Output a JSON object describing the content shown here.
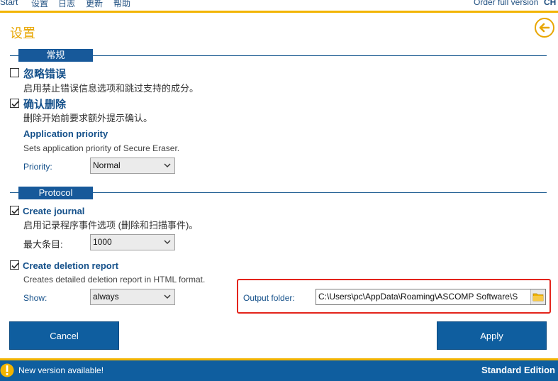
{
  "menu": {
    "items": [
      "Start",
      "设置",
      "日志",
      "更新",
      "帮助"
    ],
    "order_label": "Order full version",
    "lang_label": "CH"
  },
  "page": {
    "title": "设置"
  },
  "sections": {
    "general": "常规",
    "protocol": "Protocol"
  },
  "options": {
    "ignore_errors": {
      "title": "忽略错误",
      "desc": "启用禁止错误信息选项和跳过支持的成分。",
      "checked": false
    },
    "confirm_delete": {
      "title": "确认删除",
      "desc": "删除开始前要求额外提示确认。",
      "checked": true
    },
    "app_priority": {
      "title": "Application priority",
      "desc": "Sets application priority of Secure Eraser.",
      "label": "Priority:",
      "value": "Normal"
    },
    "create_journal": {
      "title": "Create journal",
      "desc": "启用记录程序事件选项 (删除和扫描事件)。",
      "label": "最大条目:",
      "value": "1000",
      "checked": true
    },
    "deletion_report": {
      "title": "Create deletion report",
      "desc": "Creates detailed deletion report in HTML format.",
      "label": "Show:",
      "value": "always",
      "checked": true
    },
    "output_folder": {
      "label": "Output folder:",
      "value": "C:\\Users\\pc\\AppData\\Roaming\\ASCOMP Software\\S"
    }
  },
  "buttons": {
    "cancel": "Cancel",
    "apply": "Apply"
  },
  "status": {
    "message": "New version available!",
    "edition": "Standard Edition"
  },
  "icons": {
    "back": "back-arrow-icon",
    "folder": "folder-icon",
    "warning": "warning-icon",
    "chevron": "chevron-down-icon",
    "check": "check-icon"
  },
  "colors": {
    "accent": "#f2b400",
    "brand": "#0f5e9f",
    "highlight": "#e3241b"
  }
}
